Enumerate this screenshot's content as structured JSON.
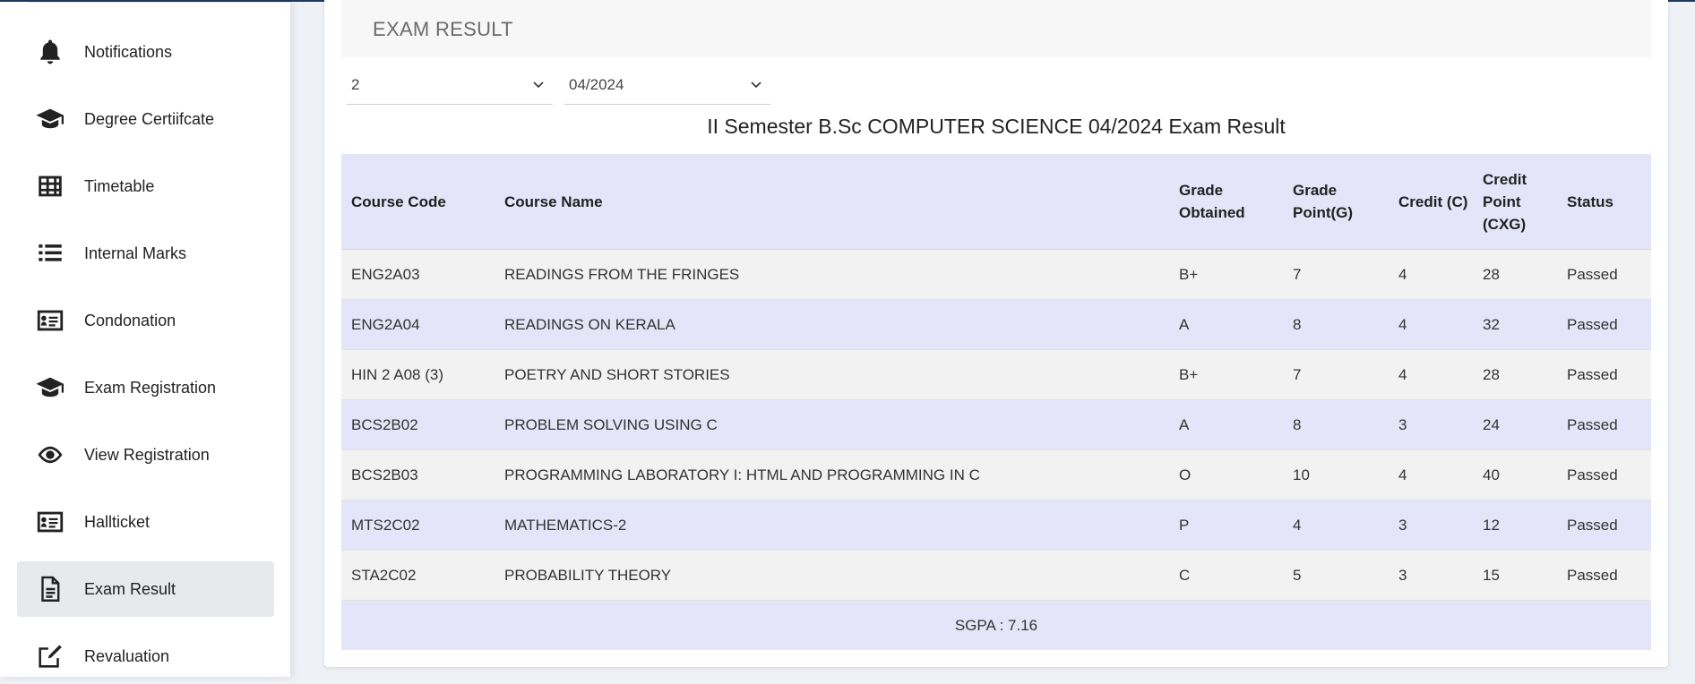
{
  "sidebar": {
    "items": [
      {
        "label": "Notifications",
        "icon": "bell-icon"
      },
      {
        "label": "Degree Certiifcate",
        "icon": "graduation-cap-icon"
      },
      {
        "label": "Timetable",
        "icon": "table-icon"
      },
      {
        "label": "Internal Marks",
        "icon": "list-icon"
      },
      {
        "label": "Condonation",
        "icon": "id-card-icon"
      },
      {
        "label": "Exam Registration",
        "icon": "graduation-cap-icon"
      },
      {
        "label": "View Registration",
        "icon": "eye-icon"
      },
      {
        "label": "Hallticket",
        "icon": "id-card-icon"
      },
      {
        "label": "Exam Result",
        "icon": "document-icon",
        "active": true
      },
      {
        "label": "Revaluation",
        "icon": "edit-icon"
      }
    ]
  },
  "main": {
    "title": "EXAM RESULT",
    "semester_select": {
      "value": "2"
    },
    "session_select": {
      "value": "04/2024"
    },
    "result_heading": "II Semester B.Sc COMPUTER SCIENCE 04/2024 Exam Result",
    "table": {
      "headers": [
        "Course Code",
        "Course Name",
        "Grade Obtained",
        "Grade Point(G)",
        "Credit (C)",
        "Credit Point (CXG)",
        "Status"
      ],
      "rows": [
        {
          "code": "ENG2A03",
          "name": "READINGS FROM THE FRINGES",
          "grade": "B+",
          "gp": "7",
          "credit": "4",
          "cp": "28",
          "status": "Passed"
        },
        {
          "code": "ENG2A04",
          "name": "READINGS ON KERALA",
          "grade": "A",
          "gp": "8",
          "credit": "4",
          "cp": "32",
          "status": "Passed"
        },
        {
          "code": "HIN 2 A08 (3)",
          "name": "POETRY AND SHORT STORIES",
          "grade": "B+",
          "gp": "7",
          "credit": "4",
          "cp": "28",
          "status": "Passed"
        },
        {
          "code": "BCS2B02",
          "name": "PROBLEM SOLVING USING C",
          "grade": "A",
          "gp": "8",
          "credit": "3",
          "cp": "24",
          "status": "Passed"
        },
        {
          "code": "BCS2B03",
          "name": "PROGRAMMING LABORATORY I: HTML AND PROGRAMMING IN C",
          "grade": "O",
          "gp": "10",
          "credit": "4",
          "cp": "40",
          "status": "Passed"
        },
        {
          "code": "MTS2C02",
          "name": "MATHEMATICS-2",
          "grade": "P",
          "gp": "4",
          "credit": "3",
          "cp": "12",
          "status": "Passed"
        },
        {
          "code": "STA2C02",
          "name": "PROBABILITY THEORY",
          "grade": "C",
          "gp": "5",
          "credit": "3",
          "cp": "15",
          "status": "Passed"
        }
      ],
      "sgpa": "SGPA : 7.16"
    }
  },
  "colors": {
    "header_bg": "#e4e5f8",
    "odd_row_bg": "#f2f2f2",
    "active_nav_bg": "#e8e9eb",
    "top_bar": "#1f3a5f"
  }
}
